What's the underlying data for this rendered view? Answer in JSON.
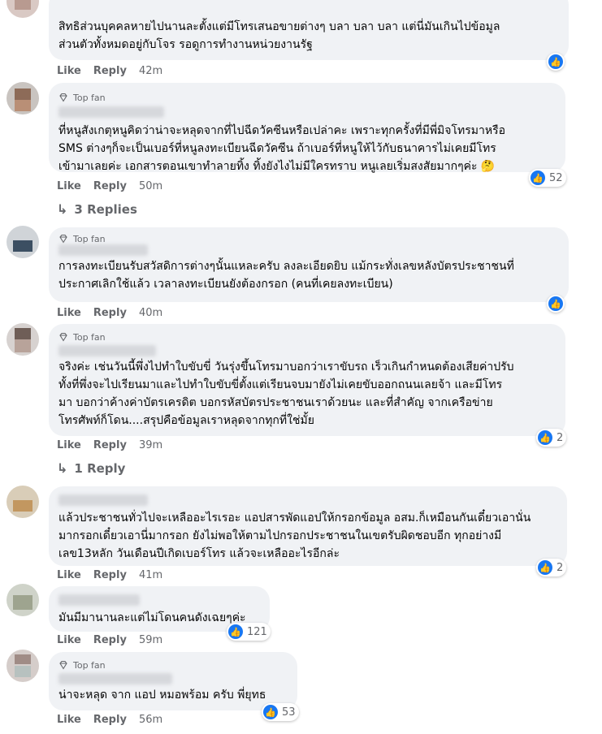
{
  "actions": {
    "like": "Like",
    "reply": "Reply"
  },
  "badge": "Top fan",
  "comments": [
    {
      "text": "สิทธิส่วนบุคคลหายไปนานละตั้งแต่มีโทรเสนอขายต่างๆ บลา บลา บลา แต่นี่มันเกินไปข้อมูล\nส่วนตัวทั้งหมดอยู่กับโจร รอดูการทำงานหน่วยงานรัฐ",
      "time": "42m",
      "reactions": ""
    },
    {
      "text": "ที่หนูสังเกตุหนูคิดว่าน่าจะหลุดจากที่ไปฉีดวัคซีนหรือเปล่าคะ เพราะทุกครั้งที่มีพี่มิจโทรมาหรือ\nSMS ต่างๆก็จะเป็นเบอร์ที่หนูลงทะเบียนฉีดวัคซีน ถ้าเบอร์ที่หนูให้ไว้กับธนาคารไม่เคยมีโทร\nเข้ามาเลยค่ะ เอกสารตอนเขาทำลายทิ้ง ทิ้งยังไงไม่มีใครทราบ หนูเลยเริ่มสงสัยมากๆค่ะ 🤔",
      "time": "50m",
      "reactions": "52",
      "replies": "3 Replies"
    },
    {
      "text": "การลงทะเบียนรับสวัสดิการต่างๆนั้นแหละครับ ลงละเอียดยิบ แม้กระทั่งเลขหลังบัตรประชาชนที่\nประกาศเลิกใช้แล้ว เวลาลงทะเบียนยังต้องกรอก (คนที่เคยลงทะเบียน)",
      "time": "40m",
      "reactions": ""
    },
    {
      "text": "จริงค่ะ เช่นวันนี้พึ่งไปทำใบขับขี่ วันรุ่งขึ้นโทรมาบอกว่าเราขับรถ เร็วเกินกำหนดต้องเสียค่าปรับ\nทั้งที่พึ่งจะไปเรียนมาและไปทำใบขับขี่ตั้งแต่เรียนจบมายังไม่เคยขับออกถนนเลยจ้า และมีโทร\nมา บอกว่าค้างค่าบัตรเครดิต บอกรหัสบัตรประชาชนเราด้วยนะ และที่สำคัญ จากเครือข่าย\nโทรศัพท์ก็โดน....สรุปคือข้อมูลเราหลุดจากทุกที่ใช่มั้ย",
      "time": "39m",
      "reactions": "2",
      "replies": "1 Reply"
    },
    {
      "text": "แล้วประชาชนทั่วไปจะเหลืออะไรเรอะ แอปสารพัดแอปให้กรอกข้อมูล อสม.ก็เหมือนกันเดี๋ยวเอานั่น\nมากรอกเดี๋ยวเอานี่มากรอก ยังไม่พอให้ตามไปกรอกประชาชนในเขตรับผิดชอบอีก ทุกอย่างมี\nเลข13หลัก วันเดือนปีเกิดเบอร์โทร แล้วจะเหลืออะไรอีกล่ะ",
      "time": "41m",
      "reactions": "2"
    },
    {
      "text": "มันมีมานานละแต่ไม่โดนคนดังเฉยๆค่ะ",
      "time": "59m",
      "reactions": "121"
    },
    {
      "text": "น่าจะหลุด จาก แอป หมอพร้อม ครับ พี่ยุทธ",
      "time": "56m",
      "reactions": "53"
    }
  ],
  "colors": {
    "bubble": "#f0f2f5",
    "meta": "#65676b",
    "like": "#1877f2",
    "haha": "#f7b125"
  },
  "icons": {
    "badge": "diamond-icon",
    "like": "thumbs-up-icon",
    "haha": "emoji-icon",
    "reply_arrow": "reply-arrow-icon"
  }
}
